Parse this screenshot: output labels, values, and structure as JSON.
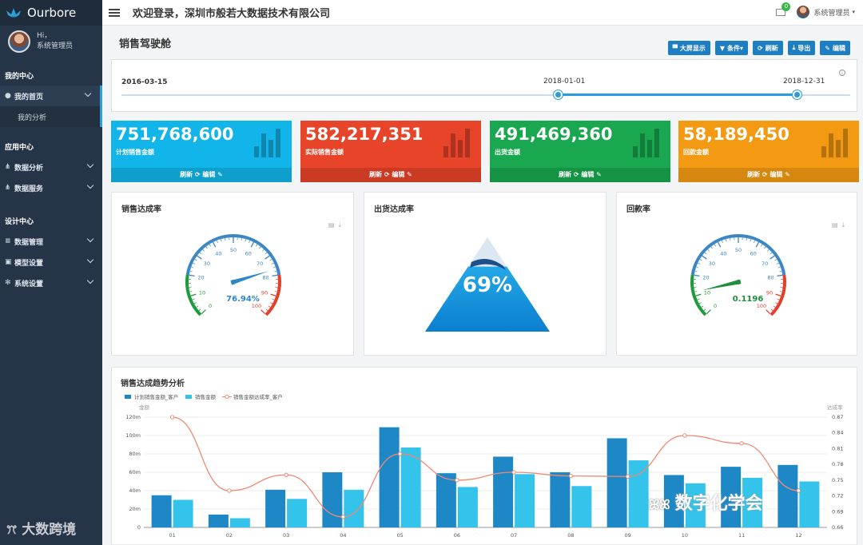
{
  "app": {
    "name": "Ourbore"
  },
  "user": {
    "greeting": "Hi，",
    "role": "系统管理员"
  },
  "sidebar": {
    "sections": [
      {
        "title": "我的中心",
        "items": [
          {
            "label": "我的首页",
            "icon": "user-icon",
            "active": true,
            "sub": [
              "我的分析"
            ]
          }
        ]
      },
      {
        "title": "应用中心",
        "items": [
          {
            "label": "数据分析",
            "icon": "sitemap-icon"
          },
          {
            "label": "数据服务",
            "icon": "sitemap-icon"
          }
        ]
      },
      {
        "title": "设计中心",
        "items": [
          {
            "label": "数据管理",
            "icon": "database-icon"
          },
          {
            "label": "模型设置",
            "icon": "cubes-icon"
          },
          {
            "label": "系统设置",
            "icon": "gear-icon"
          }
        ]
      }
    ],
    "watermark": "大数跨境"
  },
  "header": {
    "welcome": "欢迎登录，深圳市般若大数据技术有限公司",
    "notifications": "0",
    "user": "系统管理员"
  },
  "page": {
    "title": "销售驾驶舱",
    "toolbar": [
      {
        "label": "大屏显示",
        "icon": "monitor-icon"
      },
      {
        "label": "条件▾",
        "icon": "filter-icon"
      },
      {
        "label": "刷新",
        "icon": "refresh-icon"
      },
      {
        "label": "导出",
        "icon": "download-icon"
      },
      {
        "label": "编辑",
        "icon": "edit-icon"
      }
    ]
  },
  "date_slider": {
    "start": "2016-03-15",
    "from": "2018-01-01",
    "to": "2018-12-31"
  },
  "kpis": [
    {
      "value": "751,768,600",
      "label": "计划销售金额",
      "color": "#12b5ea",
      "footer": "刷新 ⟳ 编辑 ✎"
    },
    {
      "value": "582,217,351",
      "label": "实际销售金额",
      "color": "#e8442a",
      "footer": "刷新 ⟳ 编辑 ✎"
    },
    {
      "value": "491,469,360",
      "label": "出货金额",
      "color": "#19a84f",
      "footer": "刷新 ⟳ 编辑 ✎"
    },
    {
      "value": "58,189,450",
      "label": "回款金额",
      "color": "#f39a12",
      "footer": "刷新 ⟳ 编辑 ✎"
    }
  ],
  "gauges": [
    {
      "title": "销售达成率",
      "value": 76.94,
      "display": "76.94%",
      "ticks": [
        "0",
        "10",
        "20",
        "30",
        "40",
        "50",
        "60",
        "70",
        "80",
        "90",
        "100"
      ],
      "needle_color": "#2f87c8",
      "text_color": "#2f87c8"
    },
    {
      "title": "出货达成率",
      "value": 69,
      "display": "69%"
    },
    {
      "title": "回款率",
      "value": 0.1196,
      "display": "0.1196",
      "ticks": [
        "0",
        "10",
        "20",
        "30",
        "40",
        "50",
        "60",
        "70",
        "80",
        "90",
        "100"
      ],
      "needle_color": "#1e8f3a",
      "text_color": "#1e8f3a"
    }
  ],
  "chart_data": {
    "type": "bar",
    "title": "销售达成趋势分析",
    "categories": [
      "01",
      "02",
      "03",
      "04",
      "05",
      "06",
      "07",
      "08",
      "09",
      "10",
      "11",
      "12"
    ],
    "left_axis_label": "金额",
    "right_axis_label": "达成率",
    "left_ticks": [
      "0",
      "20m",
      "40m",
      "60m",
      "80m",
      "100m",
      "120m"
    ],
    "right_ticks": [
      "0.66",
      "0.69",
      "0.72",
      "0.75",
      "0.78",
      "0.81",
      "0.84",
      "0.87"
    ],
    "ylim": [
      0,
      120
    ],
    "y2lim": [
      0.66,
      0.87
    ],
    "series": [
      {
        "name": "计划销售金额_客户",
        "type": "bar",
        "color": "#1e88c7",
        "values": [
          35,
          14,
          41,
          60,
          109,
          59,
          77,
          60,
          97,
          57,
          66,
          68
        ]
      },
      {
        "name": "销售金额",
        "type": "bar",
        "color": "#34c3ea",
        "values": [
          30,
          10,
          31,
          41,
          87,
          44,
          58,
          45,
          73,
          48,
          54,
          50
        ]
      },
      {
        "name": "销售金额达成率_客户",
        "type": "line",
        "color": "#ee8a72",
        "axis": "right",
        "values": [
          0.87,
          0.73,
          0.76,
          0.68,
          0.8,
          0.75,
          0.765,
          0.758,
          0.757,
          0.835,
          0.82,
          0.73
        ]
      }
    ]
  },
  "watermark_right": "数字化学会"
}
